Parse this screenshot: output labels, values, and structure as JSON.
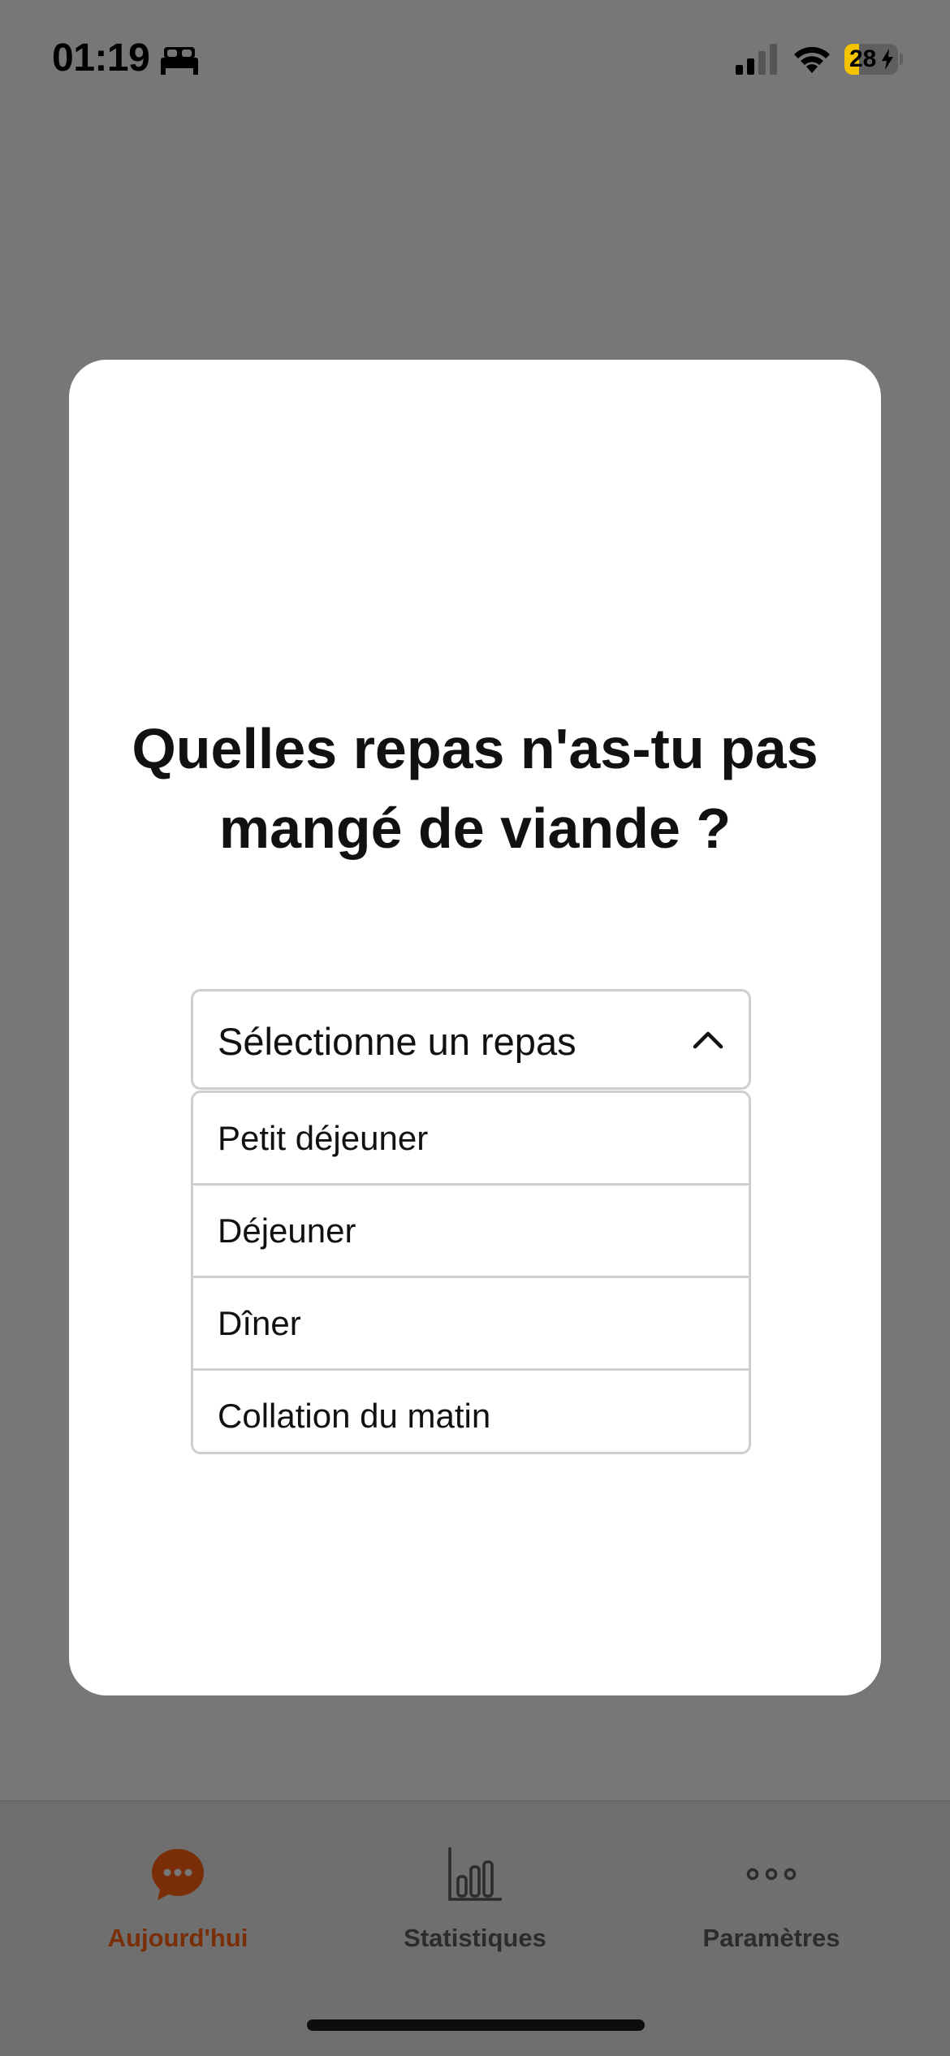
{
  "status_bar": {
    "time": "01:19",
    "battery_percent": "28",
    "battery_level": 0.28,
    "icons": [
      "bed-icon",
      "signal-icon",
      "wifi-icon",
      "battery-charging-icon"
    ]
  },
  "modal": {
    "title": "Quelles repas n'as-tu pas mangé de viande ?",
    "select": {
      "placeholder": "Sélectionne un repas",
      "expanded": true,
      "options": [
        {
          "label": "Petit déjeuner"
        },
        {
          "label": "Déjeuner"
        },
        {
          "label": "Dîner"
        },
        {
          "label": "Collation du matin"
        }
      ]
    }
  },
  "tab_bar": {
    "tabs": [
      {
        "label": "Aujourd'hui",
        "icon": "chat-bubble-icon",
        "active": true
      },
      {
        "label": "Statistiques",
        "icon": "bar-chart-icon",
        "active": false
      },
      {
        "label": "Paramètres",
        "icon": "more-dots-icon",
        "active": false
      }
    ]
  },
  "colors": {
    "overlay": "#777777",
    "accent": "#7a2e08",
    "battery_yellow": "#f5c400"
  }
}
